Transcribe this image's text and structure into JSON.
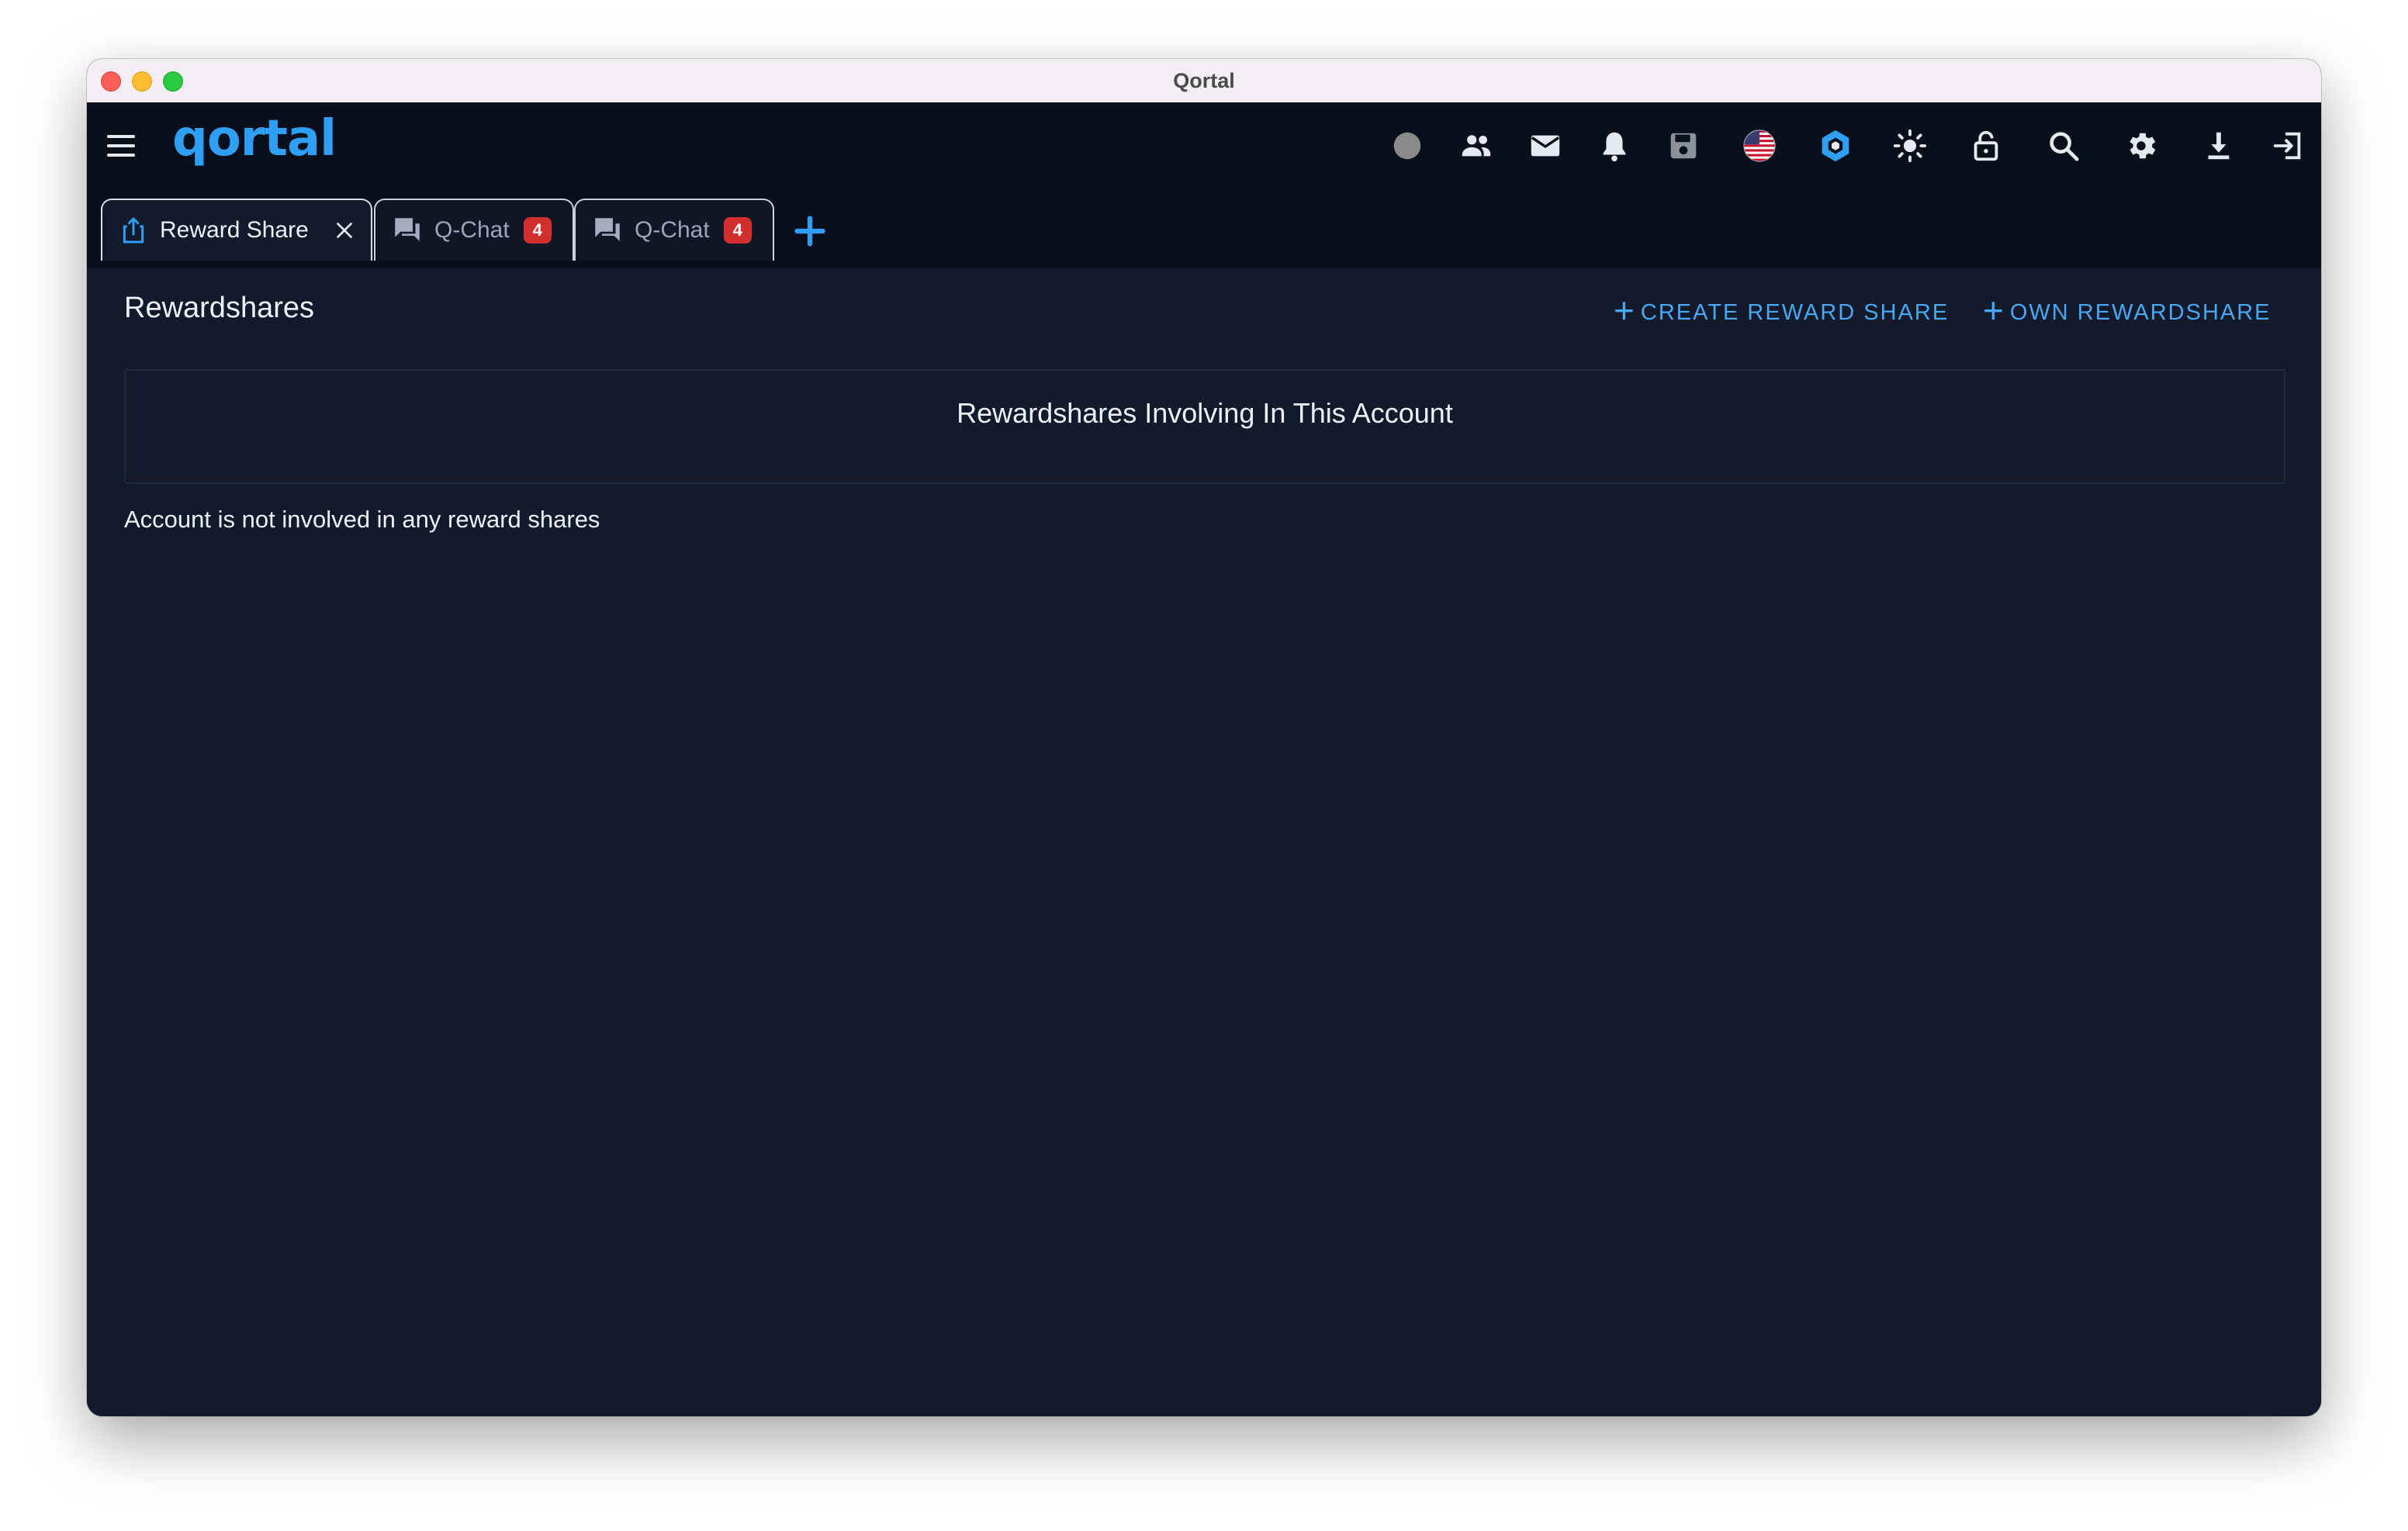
{
  "window": {
    "title": "Qortal"
  },
  "header": {
    "logo_text": "qortal",
    "icons": [
      "status-dot-icon",
      "people-icon",
      "mail-icon",
      "bell-icon",
      "save-icon",
      "us-flag-icon",
      "qortal-hex-icon",
      "brightness-icon",
      "lock-icon",
      "search-icon",
      "gear-icon",
      "download-icon",
      "logout-icon"
    ]
  },
  "tabs": [
    {
      "label": "Reward Share",
      "icon": "share-icon",
      "active": true
    },
    {
      "label": "Q-Chat",
      "icon": "chat-icon",
      "badge": "4"
    },
    {
      "label": "Q-Chat",
      "icon": "chat-icon",
      "badge": "4"
    }
  ],
  "main": {
    "title": "Rewardshares",
    "create_button": "CREATE REWARD SHARE",
    "own_button": "OWN REWARDSHARE",
    "panel_title": "Rewardshares Involving In This Account",
    "empty_message": "Account is not involved in any reward shares"
  },
  "colors": {
    "accent": "#2f9ff5",
    "badge": "#d32f2f",
    "background": "#121a2b",
    "header": "#0a0f1c"
  }
}
